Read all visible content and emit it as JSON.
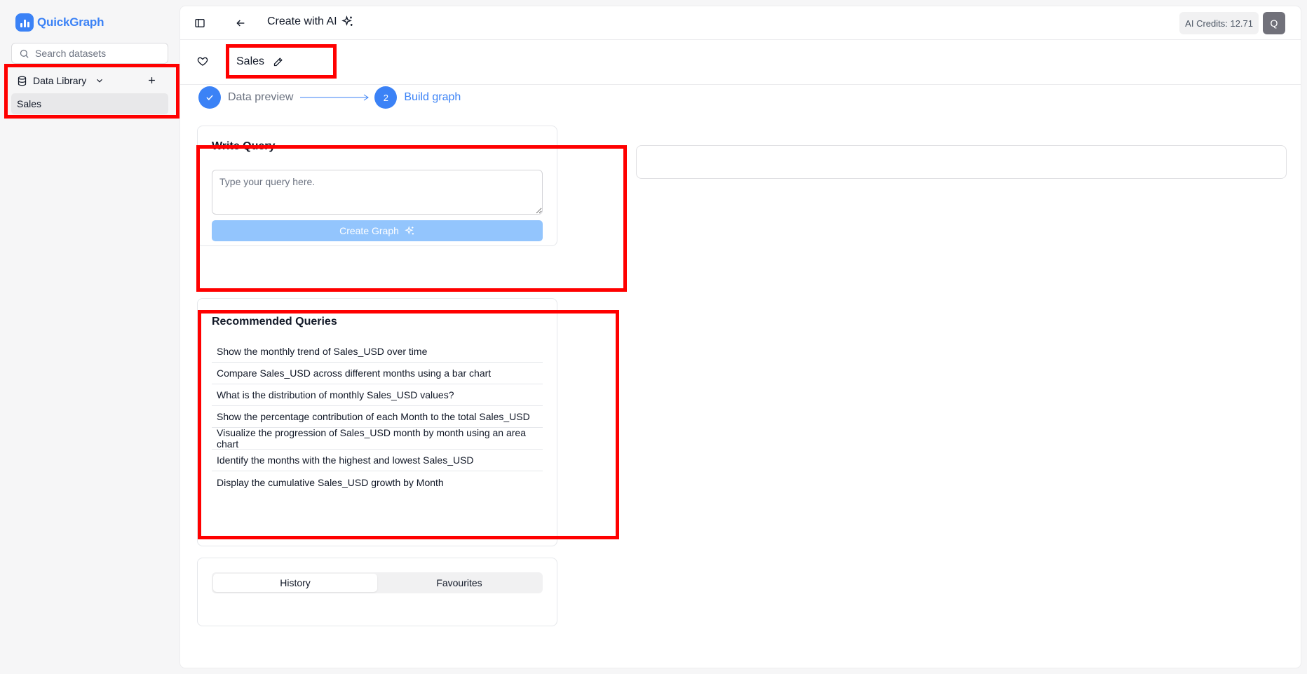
{
  "app": {
    "name": "QuickGraph"
  },
  "sidebar": {
    "search_placeholder": "Search datasets",
    "library_label": "Data Library",
    "items": [
      {
        "label": "Sales"
      }
    ]
  },
  "header": {
    "title": "Create with AI",
    "credits": "AI Credits: 12.71",
    "avatar_initial": "Q"
  },
  "dataset": {
    "name": "Sales"
  },
  "steps": [
    {
      "label": "Data preview",
      "status": "done"
    },
    {
      "number": "2",
      "label": "Build graph",
      "status": "active"
    }
  ],
  "query": {
    "title": "Write Query",
    "placeholder": "Type your query here.",
    "button_label": "Create Graph"
  },
  "recommended": {
    "title": "Recommended Queries",
    "items": [
      "Show the monthly trend of Sales_USD over time",
      "Compare Sales_USD across different months using a bar chart",
      "What is the distribution of monthly Sales_USD values?",
      "Show the percentage contribution of each Month to the total Sales_USD",
      "Visualize the progression of Sales_USD month by month using an area chart",
      "Identify the months with the highest and lowest Sales_USD",
      "Display the cumulative Sales_USD growth by Month"
    ]
  },
  "history": {
    "tabs": [
      {
        "label": "History",
        "active": true
      },
      {
        "label": "Favourites",
        "active": false
      }
    ]
  },
  "colors": {
    "accent": "#3b82f6",
    "highlight": "#ff0000",
    "button_disabled": "#93c5fd"
  }
}
